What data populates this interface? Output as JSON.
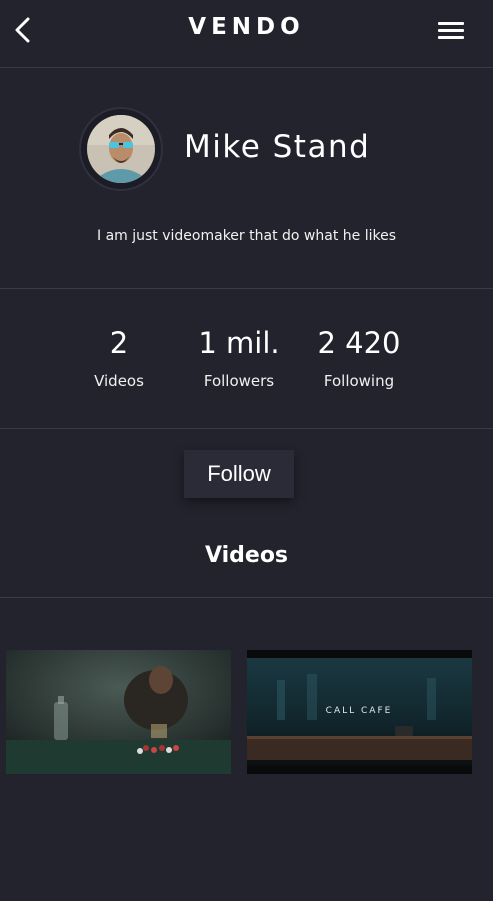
{
  "header": {
    "logo": "VENDO",
    "back_icon": "chevron-left-icon",
    "menu_icon": "hamburger-menu-icon"
  },
  "profile": {
    "name": "Mike Stand",
    "bio": "I am just videomaker that do what he likes"
  },
  "stats": [
    {
      "value": "2",
      "label": "Videos"
    },
    {
      "value": "1 mil.",
      "label": "Followers"
    },
    {
      "value": "2 420",
      "label": "Following"
    }
  ],
  "follow_label": "Follow",
  "videos": {
    "title": "Videos",
    "items": [
      {
        "caption": ""
      },
      {
        "caption": "CALL CAFE"
      }
    ]
  },
  "colors": {
    "background": "#23232e",
    "divider": "#3a3a48",
    "button": "#2b2b38",
    "text": "#ffffff"
  }
}
